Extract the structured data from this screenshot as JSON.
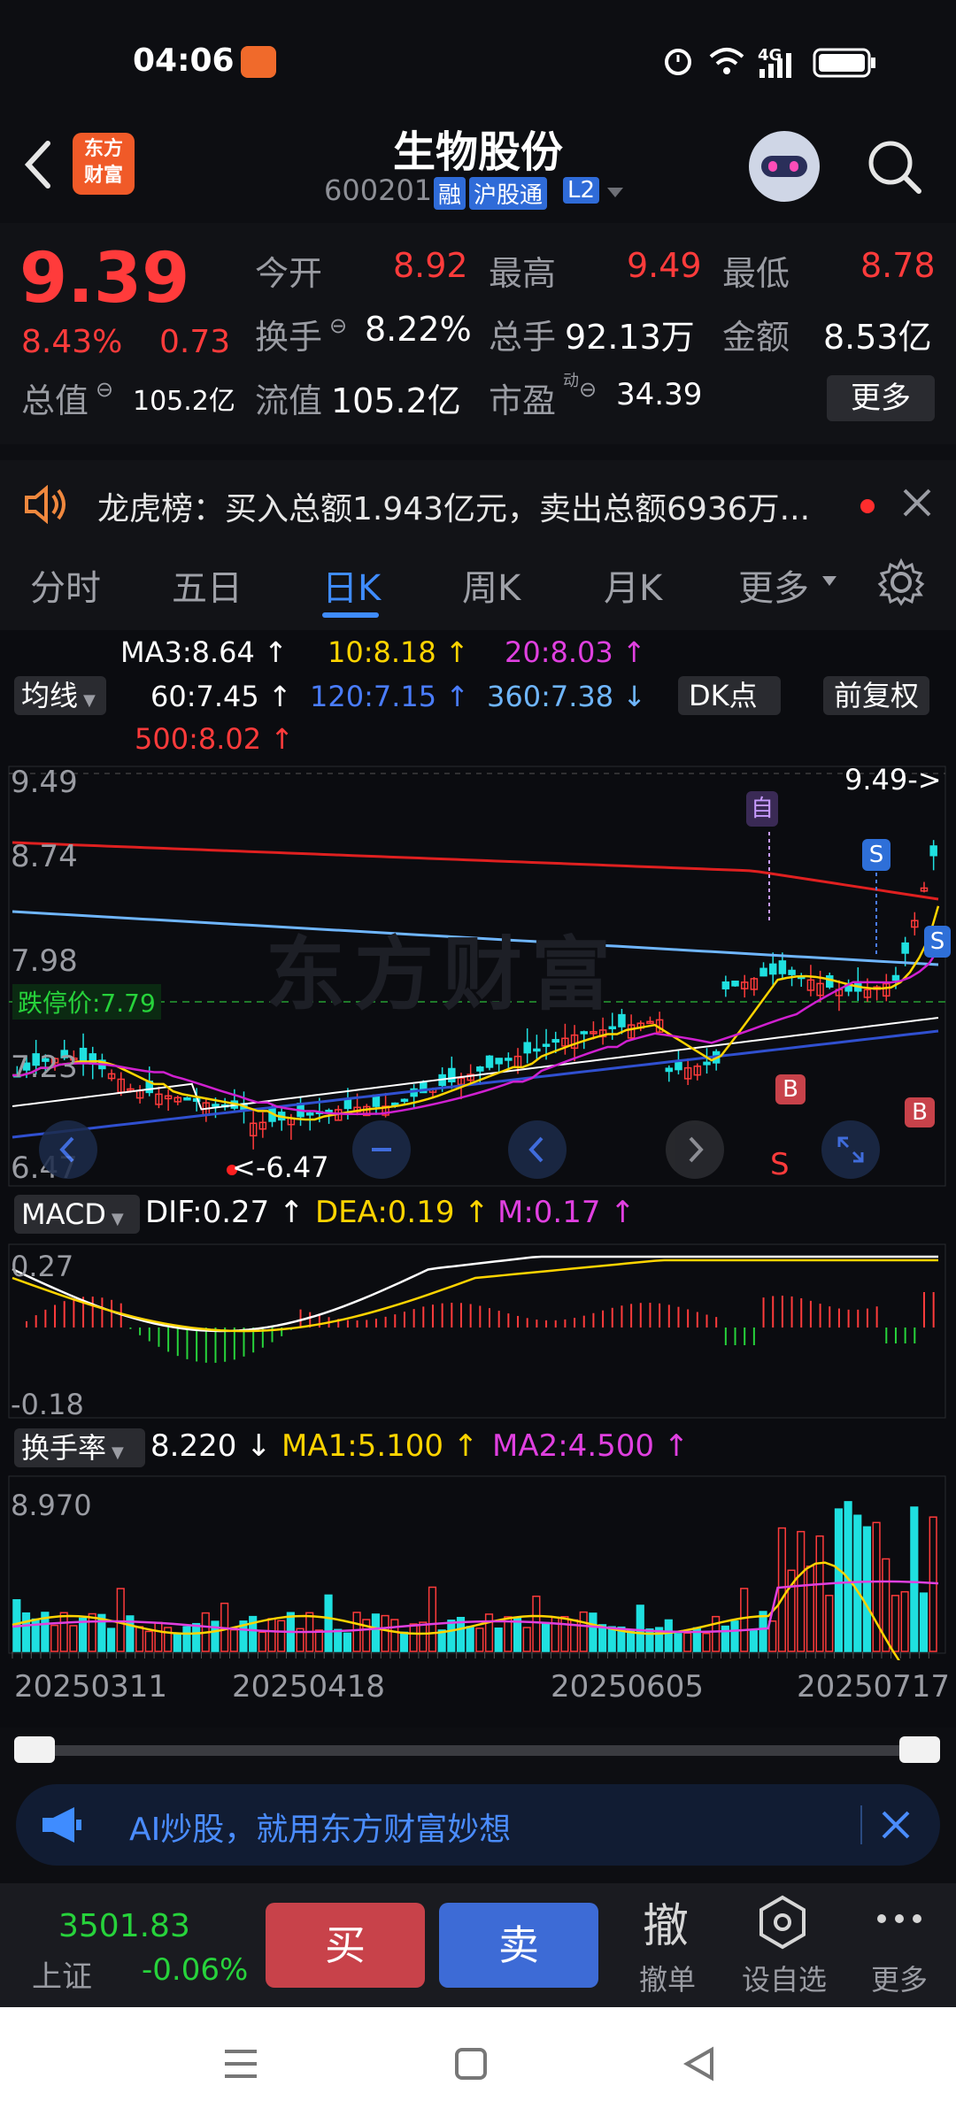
{
  "status": {
    "time": "04:06",
    "network": "4G"
  },
  "header": {
    "title": "生物股份",
    "code": "600201",
    "tag_margin": "融",
    "tag_connect": "沪股通",
    "tag_level": "L2",
    "logo_line1": "东方",
    "logo_line2": "财富"
  },
  "quote": {
    "price": "9.39",
    "change_pct": "8.43%",
    "change": "0.73",
    "open_label": "今开",
    "open": "8.92",
    "high_label": "最高",
    "high": "9.49",
    "low_label": "最低",
    "low": "8.78",
    "turnover_label": "换手",
    "turnover": "8.22%",
    "volume_label": "总手",
    "volume": "92.13万",
    "amount_label": "金额",
    "amount": "8.53亿",
    "mktcap_label": "总值",
    "mktcap": "105.2亿",
    "float_label": "流值",
    "float": "105.2亿",
    "pe_label": "市盈",
    "pe_sup": "动",
    "pe": "34.39",
    "more_btn": "更多"
  },
  "notice": {
    "text": "龙虎榜：买入总额1.943亿元，卖出总额6936万..."
  },
  "tabs": [
    {
      "label": "分时"
    },
    {
      "label": "五日"
    },
    {
      "label": "日K"
    },
    {
      "label": "周K"
    },
    {
      "label": "月K"
    },
    {
      "label": "更多"
    }
  ],
  "ma": {
    "selector": "均线",
    "ma3": "MA3:8.64 ↑",
    "ma10": "10:8.18 ↑",
    "ma20": "20:8.03 ↑",
    "ma60": "60:7.45 ↑",
    "ma120": "120:7.15 ↑",
    "ma360": "360:7.38 ↓",
    "ma500": "500:8.02 ↑",
    "dk_btn": "DK点",
    "fq_btn": "前复权"
  },
  "kline": {
    "price_labels": [
      "9.49",
      "8.74",
      "7.98",
      "7.23",
      "6.47"
    ],
    "limit_down": "跌停价:7.79",
    "high_marker": "9.49->",
    "low_marker": "<-6.47",
    "badge_zi": "自",
    "badge_s": "S",
    "badge_b": "B",
    "s_letter": "S",
    "watermark": "东方财富"
  },
  "macd": {
    "selector": "MACD",
    "dif": "DIF:0.27 ↑",
    "dea": "DEA:0.19 ↑",
    "m": "M:0.17 ↑",
    "top": "0.27",
    "bottom": "-0.18"
  },
  "turnover_panel": {
    "selector": "换手率",
    "value": "8.220 ↓",
    "ma1": "MA1:5.100 ↑",
    "ma2": "MA2:4.500 ↑",
    "top": "8.970"
  },
  "dates": [
    "20250311",
    "20250418",
    "20250605",
    "20250717"
  ],
  "ad": {
    "text": "AI炒股，就用东方财富妙想"
  },
  "bottom": {
    "index_value": "3501.83",
    "index_name": "上证",
    "index_change": "-0.06%",
    "buy": "买",
    "sell": "卖",
    "cancel_icon_char": "撤",
    "cancel": "撤单",
    "watch": "设自选",
    "more": "更多"
  },
  "colors": {
    "up": "#ff3b3b",
    "down": "#27d33b",
    "buy_bg": "#c8424a",
    "sell_bg": "#3d6bd6"
  }
}
